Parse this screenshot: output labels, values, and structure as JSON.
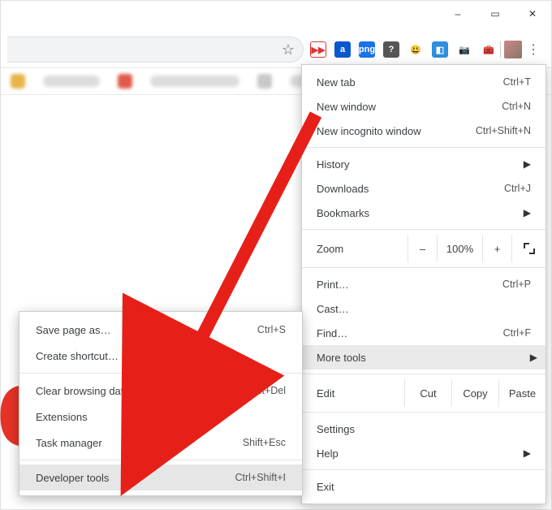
{
  "window": {
    "minimize": "–",
    "maximize": "▭",
    "close": "✕"
  },
  "omnibox": {
    "star": "☆"
  },
  "extensions": {
    "items": [
      {
        "name": "ext-record",
        "bg": "#fff",
        "fg": "#d33",
        "border": "#d33",
        "glyph": "▶▶"
      },
      {
        "name": "ext-adblock",
        "bg": "#0a57d0",
        "fg": "#fff",
        "border": "#0a57d0",
        "glyph": "a"
      },
      {
        "name": "ext-png",
        "bg": "#1a73e8",
        "fg": "#fff",
        "border": "#1a73e8",
        "glyph": "png"
      },
      {
        "name": "ext-question",
        "bg": "#555",
        "fg": "#fff",
        "border": "#555",
        "glyph": "?"
      },
      {
        "name": "ext-avatar",
        "bg": "#fff",
        "fg": "#333",
        "border": "#fff",
        "glyph": "😃"
      },
      {
        "name": "ext-tag",
        "bg": "#2d8fdd",
        "fg": "#fff",
        "border": "#2d8fdd",
        "glyph": "◧"
      },
      {
        "name": "ext-camera",
        "bg": "#fff",
        "fg": "#777",
        "border": "#fff",
        "glyph": "📷"
      },
      {
        "name": "ext-toolbox",
        "bg": "#fff",
        "fg": "#d44",
        "border": "#fff",
        "glyph": "🧰"
      }
    ]
  },
  "menu": {
    "new_tab": "New tab",
    "new_tab_accel": "Ctrl+T",
    "new_window": "New window",
    "new_window_accel": "Ctrl+N",
    "incognito": "New incognito window",
    "incognito_accel": "Ctrl+Shift+N",
    "history": "History",
    "downloads": "Downloads",
    "downloads_accel": "Ctrl+J",
    "bookmarks": "Bookmarks",
    "zoom_label": "Zoom",
    "zoom_minus": "–",
    "zoom_value": "100%",
    "zoom_plus": "+",
    "print": "Print…",
    "print_accel": "Ctrl+P",
    "cast": "Cast…",
    "find": "Find…",
    "find_accel": "Ctrl+F",
    "more_tools": "More tools",
    "edit": "Edit",
    "cut": "Cut",
    "copy": "Copy",
    "paste": "Paste",
    "settings": "Settings",
    "help": "Help",
    "exit": "Exit"
  },
  "submenu": {
    "save_page": "Save page as…",
    "save_page_accel": "Ctrl+S",
    "create_shortcut": "Create shortcut…",
    "clear_browsing": "Clear browsing data…",
    "clear_browsing_accel": "Ctrl+Shift+Del",
    "extensions": "Extensions",
    "task_manager": "Task manager",
    "task_manager_accel": "Shift+Esc",
    "dev_tools": "Developer tools",
    "dev_tools_accel": "Ctrl+Shift+I"
  },
  "kebab": "⋮",
  "arrow_tri": "▶"
}
